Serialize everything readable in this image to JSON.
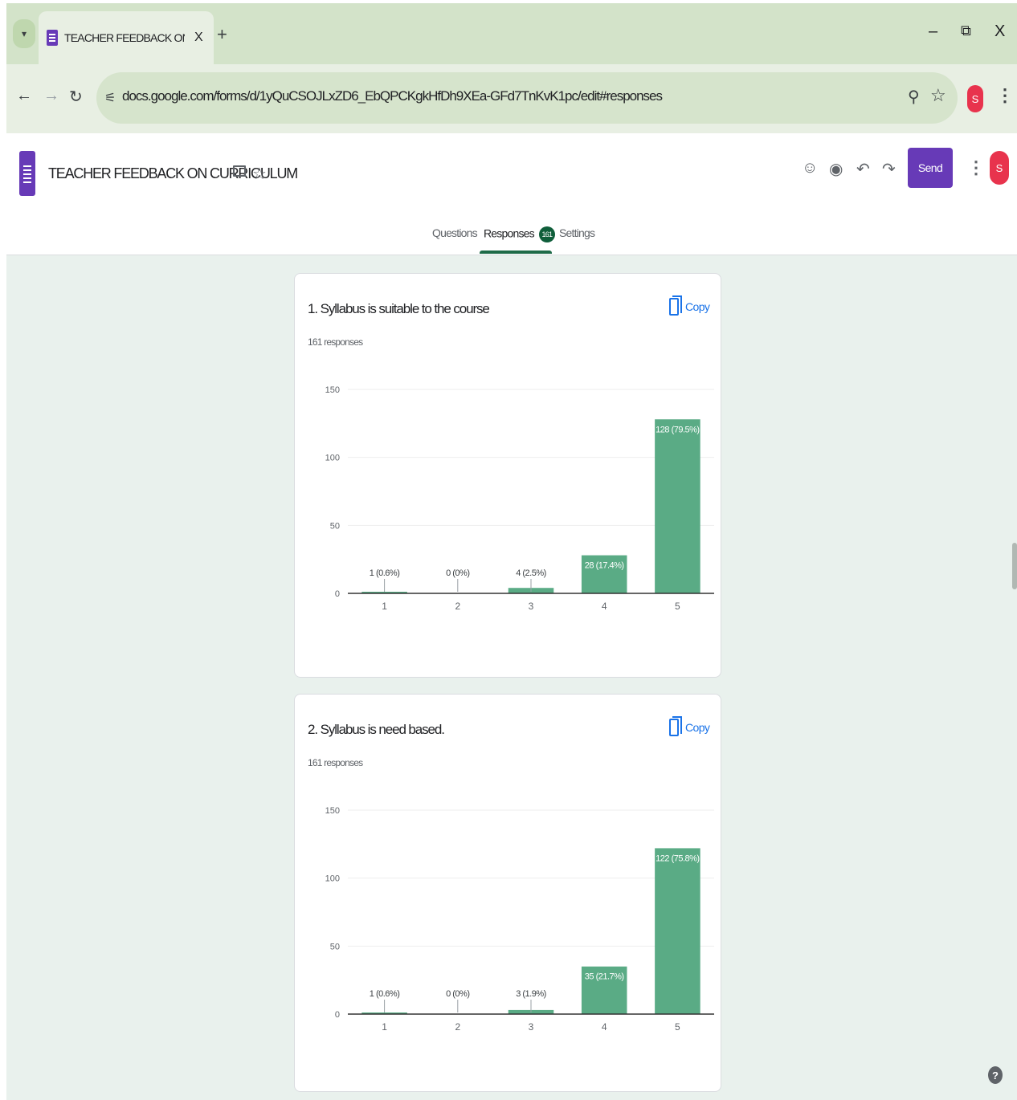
{
  "browser": {
    "tab_title": "TEACHER FEEDBACK ON CURR",
    "tab_close": "X",
    "new_tab": "+",
    "url": "docs.google.com/forms/d/1yQuCSOJLxZD6_EbQPCKgkHfDh9XEa-GFd7TnKvK1pc/edit#responses",
    "profile_initial": "S",
    "window_controls": {
      "minimize": "–",
      "restore": "⧉",
      "close": "X"
    }
  },
  "header": {
    "form_title": "TEACHER FEEDBACK ON CURRICULUM",
    "send_label": "Send",
    "profile_initial": "S",
    "tabs": [
      {
        "label": "Questions"
      },
      {
        "label": "Responses",
        "badge": "161"
      },
      {
        "label": "Settings"
      }
    ]
  },
  "colors": {
    "accent": "#673ab7",
    "bar": "#5aab85",
    "tab_active": "#1e6b48",
    "link": "#1a73e8",
    "background": "#e9f1ed"
  },
  "icons": [
    "palette-icon",
    "preview-icon",
    "undo-icon",
    "redo-icon",
    "folder-icon",
    "star-icon",
    "copy-icon",
    "help-icon"
  ],
  "questions": [
    {
      "title": "1. Syllabus is suitable to the course",
      "responses": "161 responses",
      "copy_label": "Copy"
    },
    {
      "title": "2. Syllabus is need based.",
      "responses": "161 responses",
      "copy_label": "Copy"
    }
  ],
  "chart_data": [
    {
      "type": "bar",
      "categories": [
        "1",
        "2",
        "3",
        "4",
        "5"
      ],
      "values": [
        1,
        0,
        4,
        28,
        128
      ],
      "labels": [
        "1 (0.6%)",
        "0 (0%)",
        "4 (2.5%)",
        "28 (17.4%)",
        "128 (79.5%)"
      ],
      "yticks": [
        0,
        50,
        100,
        150
      ],
      "ylim": [
        0,
        150
      ],
      "grid": true
    },
    {
      "type": "bar",
      "categories": [
        "1",
        "2",
        "3",
        "4",
        "5"
      ],
      "values": [
        1,
        0,
        3,
        35,
        122
      ],
      "labels": [
        "1 (0.6%)",
        "0 (0%)",
        "3 (1.9%)",
        "35 (21.7%)",
        "122 (75.8%)"
      ],
      "yticks": [
        0,
        50,
        100,
        150
      ],
      "ylim": [
        0,
        150
      ],
      "grid": true
    }
  ]
}
